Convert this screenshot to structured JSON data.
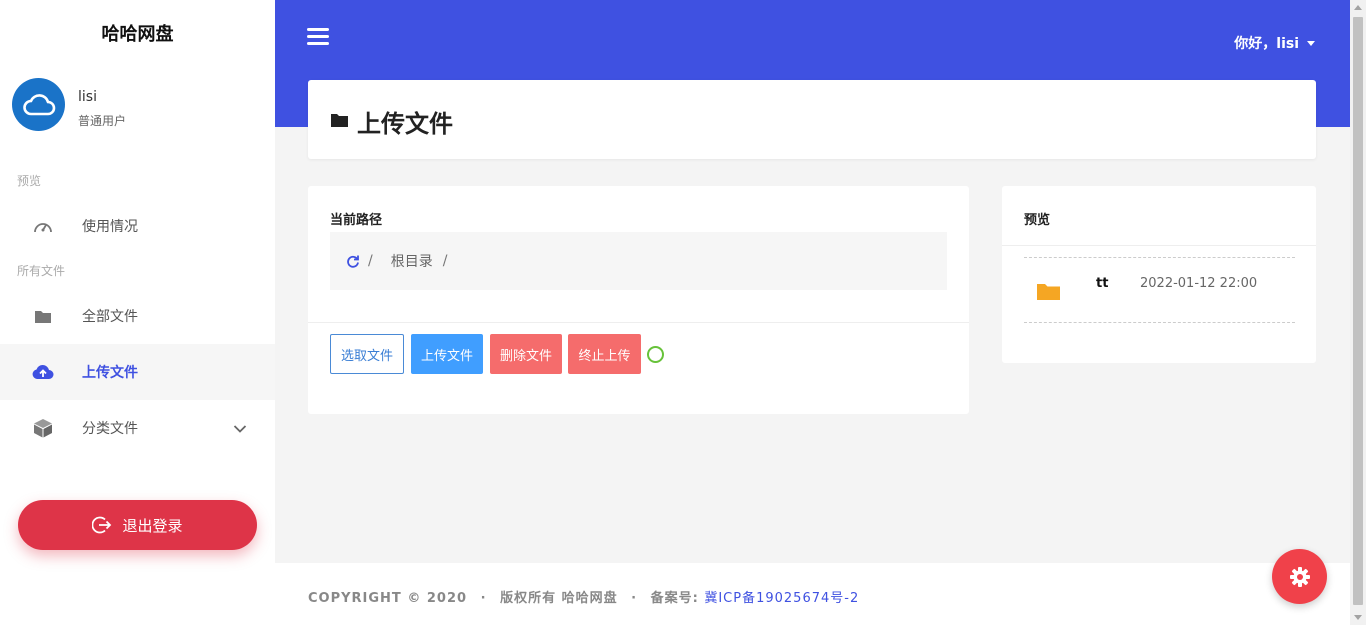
{
  "app": {
    "brand": "哈哈网盘"
  },
  "user": {
    "name": "lisi",
    "role": "普通用户"
  },
  "sidebar": {
    "sections": [
      {
        "label": "预览"
      },
      {
        "label": "所有文件"
      }
    ],
    "items": [
      {
        "label": "使用情况",
        "icon": "dashboard-icon"
      },
      {
        "label": "全部文件",
        "icon": "folder-icon"
      },
      {
        "label": "上传文件",
        "icon": "cloud-upload-icon",
        "active": true
      },
      {
        "label": "分类文件",
        "icon": "cube-icon"
      }
    ],
    "logout_label": "退出登录"
  },
  "header": {
    "greeting": "你好，lisi"
  },
  "page": {
    "title": "上传文件"
  },
  "upload": {
    "path_label": "当前路径",
    "breadcrumb": {
      "separator": "/",
      "root": "根目录"
    },
    "buttons": {
      "choose": "选取文件",
      "upload": "上传文件",
      "delete": "删除文件",
      "stop": "终止上传"
    }
  },
  "preview": {
    "title": "预览",
    "files": [
      {
        "name": "tt",
        "date": "2022-01-12 22:00",
        "icon": "folder-icon"
      }
    ]
  },
  "footer": {
    "copyright": "COPYRIGHT © 2020",
    "rights": "版权所有 哈哈网盘",
    "icp_label": "备案号:",
    "icp_number": "冀ICP备19025674号-2"
  },
  "colors": {
    "primary": "#3f51e1",
    "danger": "#de3448",
    "upload": "#409eff",
    "delete": "#f56c6c",
    "success": "#67c23a",
    "folder": "#f5a623"
  }
}
